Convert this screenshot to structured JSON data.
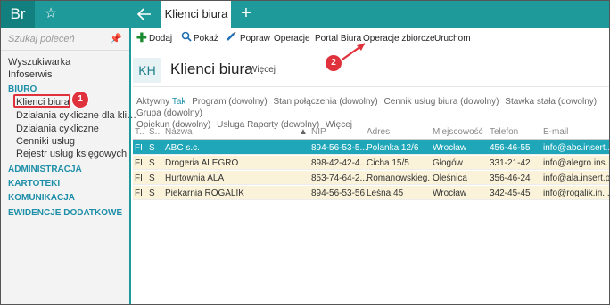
{
  "app": {
    "brand": "Br"
  },
  "tabs": {
    "active": "Klienci biura"
  },
  "sidebar": {
    "search_placeholder": "Szukaj poleceń",
    "items": [
      "Wyszukiwarka",
      "Infoserwis"
    ],
    "sections": {
      "biuro": "BIURO",
      "administracja": "ADMINISTRACJA",
      "kartoteki": "KARTOTEKI",
      "komunikacja": "KOMUNIKACJA",
      "ewidencje": "EWIDENCJE DODATKOWE"
    },
    "biuro_items": [
      "Klienci biura",
      "Działania cykliczne dla kli…",
      "Działania cykliczne",
      "Cenniki usług",
      "Rejestr usług księgowych"
    ]
  },
  "toolbar": {
    "add": "Dodaj",
    "show": "Pokaż",
    "fix": "Popraw",
    "operations": "Operacje",
    "portal": "Portal Biura",
    "bulk_ops": "Operacje zbiorcze",
    "run": "Uruchom"
  },
  "header": {
    "badge": "KH",
    "title": "Klienci biura",
    "more": "Więcej"
  },
  "filters": {
    "active_label": "Aktywny",
    "active_value": "Tak",
    "program": "Program (dowolny)",
    "connection": "Stan połączenia (dowolny)",
    "price_list": "Cennik usług biura (dowolny)",
    "fixed_rate": "Stawka stała (dowolny)",
    "group": "Grupa (dowolny)",
    "guardian": "Opiekun (dowolny)",
    "reports": "Usługa Raporty (dowolny)",
    "more": "Więcej"
  },
  "table": {
    "headers": [
      "T..",
      "S..",
      "Nazwa",
      "NIP",
      "Adres",
      "Miejscowość",
      "Telefon",
      "E-mail"
    ],
    "rows": [
      [
        "FI",
        "S",
        "ABC s.c.",
        "894-56-53-5...",
        "Polanka  12/6",
        "Wrocław",
        "456-46-55",
        "info@abc.insert..."
      ],
      [
        "FI",
        "S",
        "Drogeria ALEGRO",
        "898-42-42-4...",
        "Cicha  15/5",
        "Głogów",
        "331-21-42",
        "info@alegro.ins..."
      ],
      [
        "FI",
        "S",
        "Hurtownia ALA",
        "853-74-64-2...",
        "Romanowskieg...",
        "Oleśnica",
        "356-46-24",
        "info@ala.insert.pl"
      ],
      [
        "FI",
        "S",
        "Piekarnia ROGALIK",
        "894-56-53-56",
        "Leśna  45",
        "Wrocław",
        "342-45-45",
        "info@rogalik.in..."
      ]
    ]
  },
  "annotations": {
    "step1": "1",
    "step2": "2"
  },
  "colors": {
    "accent": "#1e9a9a",
    "annotation": "#e0323c",
    "section": "#1e8fa8",
    "row_highlight": "#fbf3d9"
  }
}
